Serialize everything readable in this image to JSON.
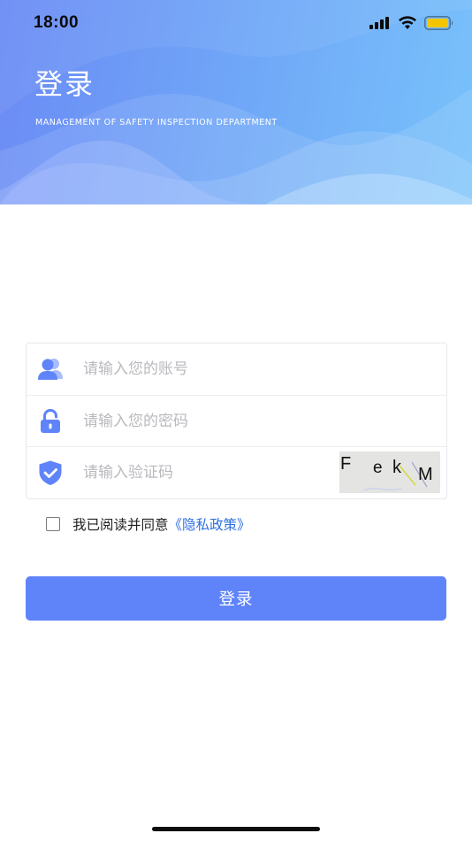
{
  "status_bar": {
    "time": "18:00",
    "icons": [
      "signal-icon",
      "wifi-icon",
      "battery-icon"
    ]
  },
  "header": {
    "title": "登录",
    "subtitle": "MANAGEMENT OF SAFETY INSPECTION DEPARTMENT"
  },
  "form": {
    "account": {
      "icon": "user-icon",
      "placeholder": "请输入您的账号",
      "value": ""
    },
    "password": {
      "icon": "lock-icon",
      "placeholder": "请输入您的密码",
      "value": ""
    },
    "captcha": {
      "icon": "shield-icon",
      "placeholder": "请输入验证码",
      "value": "",
      "image_text": [
        "F",
        "e",
        "k",
        "M"
      ]
    }
  },
  "agreement": {
    "checked": false,
    "text": "我已阅读并同意",
    "link": "《隐私政策》"
  },
  "login_button": {
    "label": "登录"
  },
  "colors": {
    "accent": "#5f84fa",
    "link": "#2d6fe0",
    "icon": "#5f84fa",
    "header_gradient_start": "#6b8bf5",
    "header_gradient_end": "#78c2fb"
  }
}
